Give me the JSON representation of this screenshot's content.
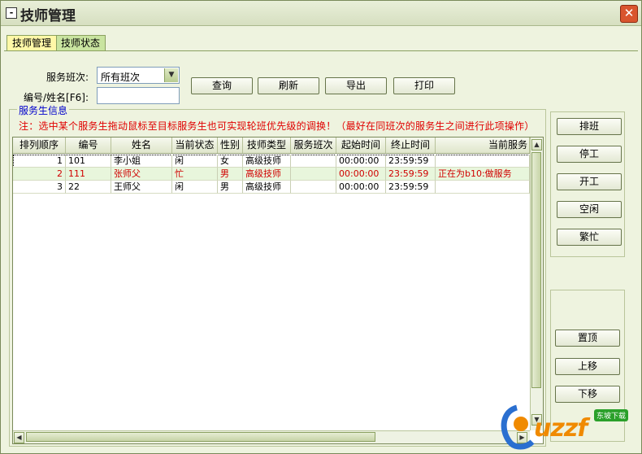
{
  "window": {
    "title": "技师管理"
  },
  "tabs": [
    {
      "label": "技师管理",
      "active": true
    },
    {
      "label": "技师状态",
      "active": false
    }
  ],
  "filters": {
    "shift_label": "服务班次:",
    "shift_value": "所有班次",
    "id_name_label": "编号/姓名[F6]:",
    "id_name_value": ""
  },
  "toolbar": {
    "query": "查询",
    "refresh": "刷新",
    "export": "导出",
    "print": "打印"
  },
  "group": {
    "title": "服务生信息",
    "note": "注：选中某个服务生拖动鼠标至目标服务生也可实现轮班优先级的调换！（最好在同班次的服务生之间进行此项操作）"
  },
  "table": {
    "columns": [
      "排列顺序",
      "编号",
      "姓名",
      "当前状态",
      "性别",
      "技师类型",
      "服务班次",
      "起始时间",
      "终止时间",
      "当前服务"
    ],
    "rows": [
      [
        "1",
        "101",
        "李小姐",
        "闲",
        "女",
        "高级技师",
        "",
        "00:00:00",
        "23:59:59",
        ""
      ],
      [
        "2",
        "111",
        "张师父",
        "忙",
        "男",
        "高级技师",
        "",
        "00:00:00",
        "23:59:59",
        "正在为b10:做服务"
      ],
      [
        "3",
        "22",
        "王师父",
        "闲",
        "男",
        "高级技师",
        "",
        "00:00:00",
        "23:59:59",
        ""
      ]
    ]
  },
  "side_buttons": {
    "schedule": "排班",
    "stop": "停工",
    "start": "开工",
    "idle": "空闲",
    "busy": "繁忙"
  },
  "order_buttons": {
    "top": "置顶",
    "up": "上移",
    "down": "下移"
  },
  "watermark": {
    "text": "uzzf",
    "badge": "东坡下载"
  },
  "colors": {
    "accent_red": "#e00000",
    "group_title": "#0000cc",
    "tab_active": "#fff8a8",
    "tab_inactive": "#c9e4a0"
  }
}
